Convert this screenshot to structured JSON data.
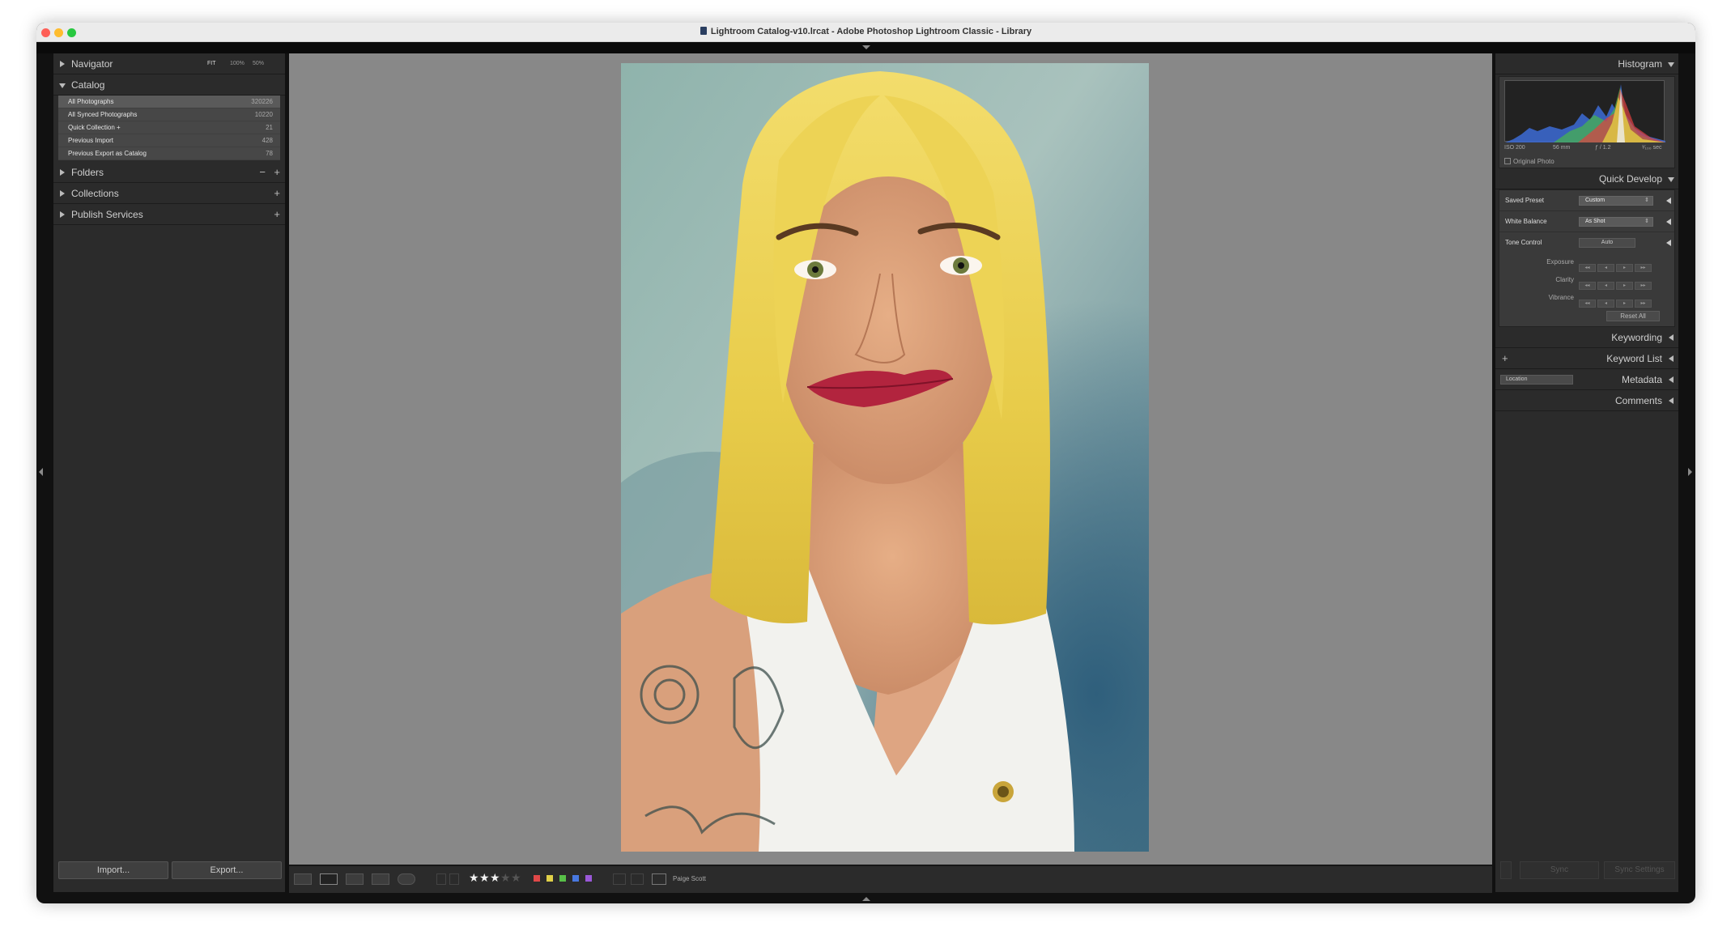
{
  "window": {
    "title": "Lightroom Catalog-v10.lrcat - Adobe Photoshop Lightroom Classic - Library"
  },
  "left_panel": {
    "navigator": {
      "label": "Navigator",
      "zoom_options": [
        "FIT",
        "100%",
        "50%"
      ]
    },
    "catalog": {
      "label": "Catalog",
      "items": [
        {
          "label": "All Photographs",
          "count": "320226"
        },
        {
          "label": "All Synced Photographs",
          "count": "10220"
        },
        {
          "label": "Quick Collection +",
          "count": "21"
        },
        {
          "label": "Previous Import",
          "count": "428"
        },
        {
          "label": "Previous Export as Catalog",
          "count": "78"
        }
      ]
    },
    "folders_label": "Folders",
    "collections_label": "Collections",
    "publish_services_label": "Publish Services",
    "import_label": "Import...",
    "export_label": "Export..."
  },
  "right_panel": {
    "histogram": {
      "label": "Histogram",
      "iso": "ISO 200",
      "focal_length": "56 mm",
      "aperture": "ƒ / 1.2",
      "shutter": "¹⁄₁₀₀ sec",
      "original_photo_label": "Original Photo"
    },
    "quick_develop": {
      "label": "Quick Develop",
      "saved_preset_label": "Saved Preset",
      "saved_preset_value": "Custom",
      "white_balance_label": "White Balance",
      "white_balance_value": "As Shot",
      "tone_control_label": "Tone Control",
      "auto_label": "Auto",
      "exposure_label": "Exposure",
      "clarity_label": "Clarity",
      "vibrance_label": "Vibrance",
      "reset_all_label": "Reset All"
    },
    "keywording_label": "Keywording",
    "keyword_list_label": "Keyword List",
    "metadata_label": "Metadata",
    "metadata_preset": "Location",
    "comments_label": "Comments",
    "sync_label": "Sync",
    "sync_settings_label": "Sync Settings"
  },
  "toolbar": {
    "rating": 3,
    "max_rating": 5,
    "color_labels": [
      "#e04848",
      "#e0d048",
      "#58c048",
      "#4878e0",
      "#9a58d8"
    ],
    "person_name": "Paige Scott"
  }
}
